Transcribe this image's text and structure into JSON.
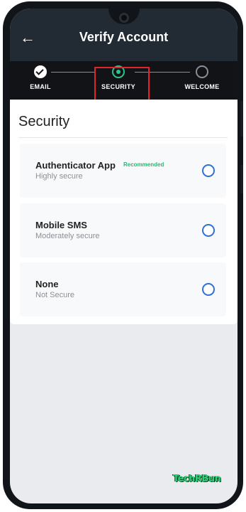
{
  "appbar": {
    "back_icon": "arrow-left-icon",
    "title": "Verify Account"
  },
  "stepper": {
    "steps": [
      {
        "label": "EMAIL",
        "state": "done"
      },
      {
        "label": "SECURITY",
        "state": "active"
      },
      {
        "label": "WELCOME",
        "state": "pending"
      }
    ],
    "highlight_color": "#e0242c",
    "active_color": "#2bc48a"
  },
  "section": {
    "title": "Security"
  },
  "options": [
    {
      "title": "Authenticator App",
      "badge": "Recommended",
      "subtitle": "Highly secure",
      "selected": false
    },
    {
      "title": "Mobile SMS",
      "badge": "",
      "subtitle": "Moderately secure",
      "selected": false
    },
    {
      "title": "None",
      "badge": "",
      "subtitle": "Not Secure",
      "selected": false
    }
  ],
  "colors": {
    "radio": "#2f6fd8",
    "badge": "#2bb673",
    "appbar": "#222a33"
  },
  "watermark": "TechRBun"
}
